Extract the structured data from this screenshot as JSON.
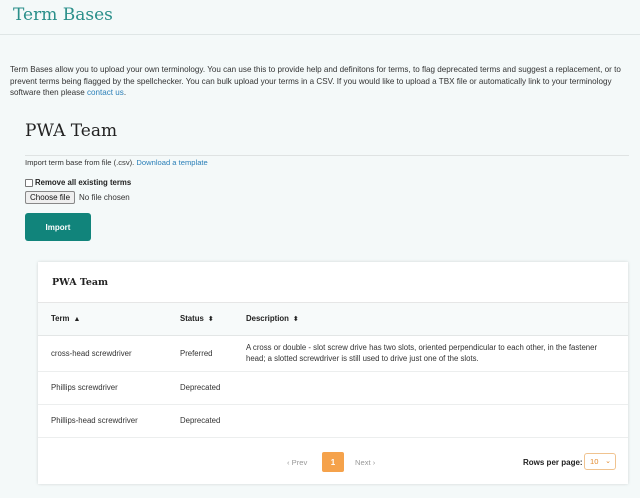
{
  "page": {
    "title": "Term Bases",
    "intro_text": "Term Bases allow you to upload your own terminology. You can use this to provide help and definitons for terms, to flag deprecated terms and suggest a replacement, or to prevent terms being flagged by the spellchecker. You can bulk upload your terms in a CSV. If you would like to upload a TBX file or automatically link to your terminology software then please ",
    "contact_link": "contact us",
    "intro_end": "."
  },
  "team": {
    "name": "PWA Team",
    "import_label": "Import term base from file (.csv).",
    "template_link": "Download a template",
    "remove_label": "Remove all existing terms",
    "choose_file": "Choose file",
    "no_file": "No file chosen",
    "import_button": "Import"
  },
  "table": {
    "title": "PWA Team",
    "columns": [
      {
        "label": "Term",
        "sort": "▲"
      },
      {
        "label": "Status",
        "sort": "⬍"
      },
      {
        "label": "Description",
        "sort": "⬍"
      }
    ],
    "rows": [
      {
        "term": "cross-head screwdriver",
        "status": "Preferred",
        "description": "A cross or double - slot screw drive has two slots, oriented perpendicular to each other, in the fastener head; a slotted screwdriver is still used to drive just one of the slots."
      },
      {
        "term": "Phillips screwdriver",
        "status": "Deprecated",
        "description": ""
      },
      {
        "term": "Phillips-head screwdriver",
        "status": "Deprecated",
        "description": ""
      }
    ]
  },
  "pagination": {
    "prev": "‹ Prev",
    "current": "1",
    "next": "Next ›",
    "rows_label": "Rows per page:",
    "rows_value": "10"
  },
  "colors": {
    "accent": "#11847b",
    "title": "#2a8f8a",
    "link": "#2a7fb8",
    "page_active": "#f5a24b"
  }
}
